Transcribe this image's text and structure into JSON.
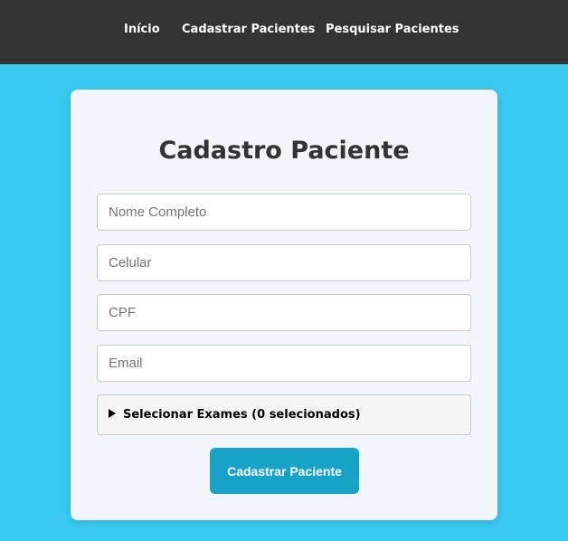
{
  "nav": {
    "items": [
      {
        "label": "Início"
      },
      {
        "label": "Cadastrar Pacientes"
      },
      {
        "label": "Pesquisar Pacientes"
      }
    ]
  },
  "form": {
    "title": "Cadastro Paciente",
    "fields": {
      "nome": {
        "placeholder": "Nome Completo",
        "value": ""
      },
      "celular": {
        "placeholder": "Celular",
        "value": ""
      },
      "cpf": {
        "placeholder": "CPF",
        "value": ""
      },
      "email": {
        "placeholder": "Email",
        "value": ""
      }
    },
    "exams_toggle_label": "Selecionar Exames (0 selecionados)",
    "exams_selected_count": 0,
    "submit_label": "Cadastrar Paciente"
  },
  "colors": {
    "background": "#3ac9ef",
    "navbar": "#333333",
    "card": "#f2f5f9",
    "button": "#17a2c8"
  },
  "icons": {
    "exams_toggle": "caret-right-icon"
  }
}
